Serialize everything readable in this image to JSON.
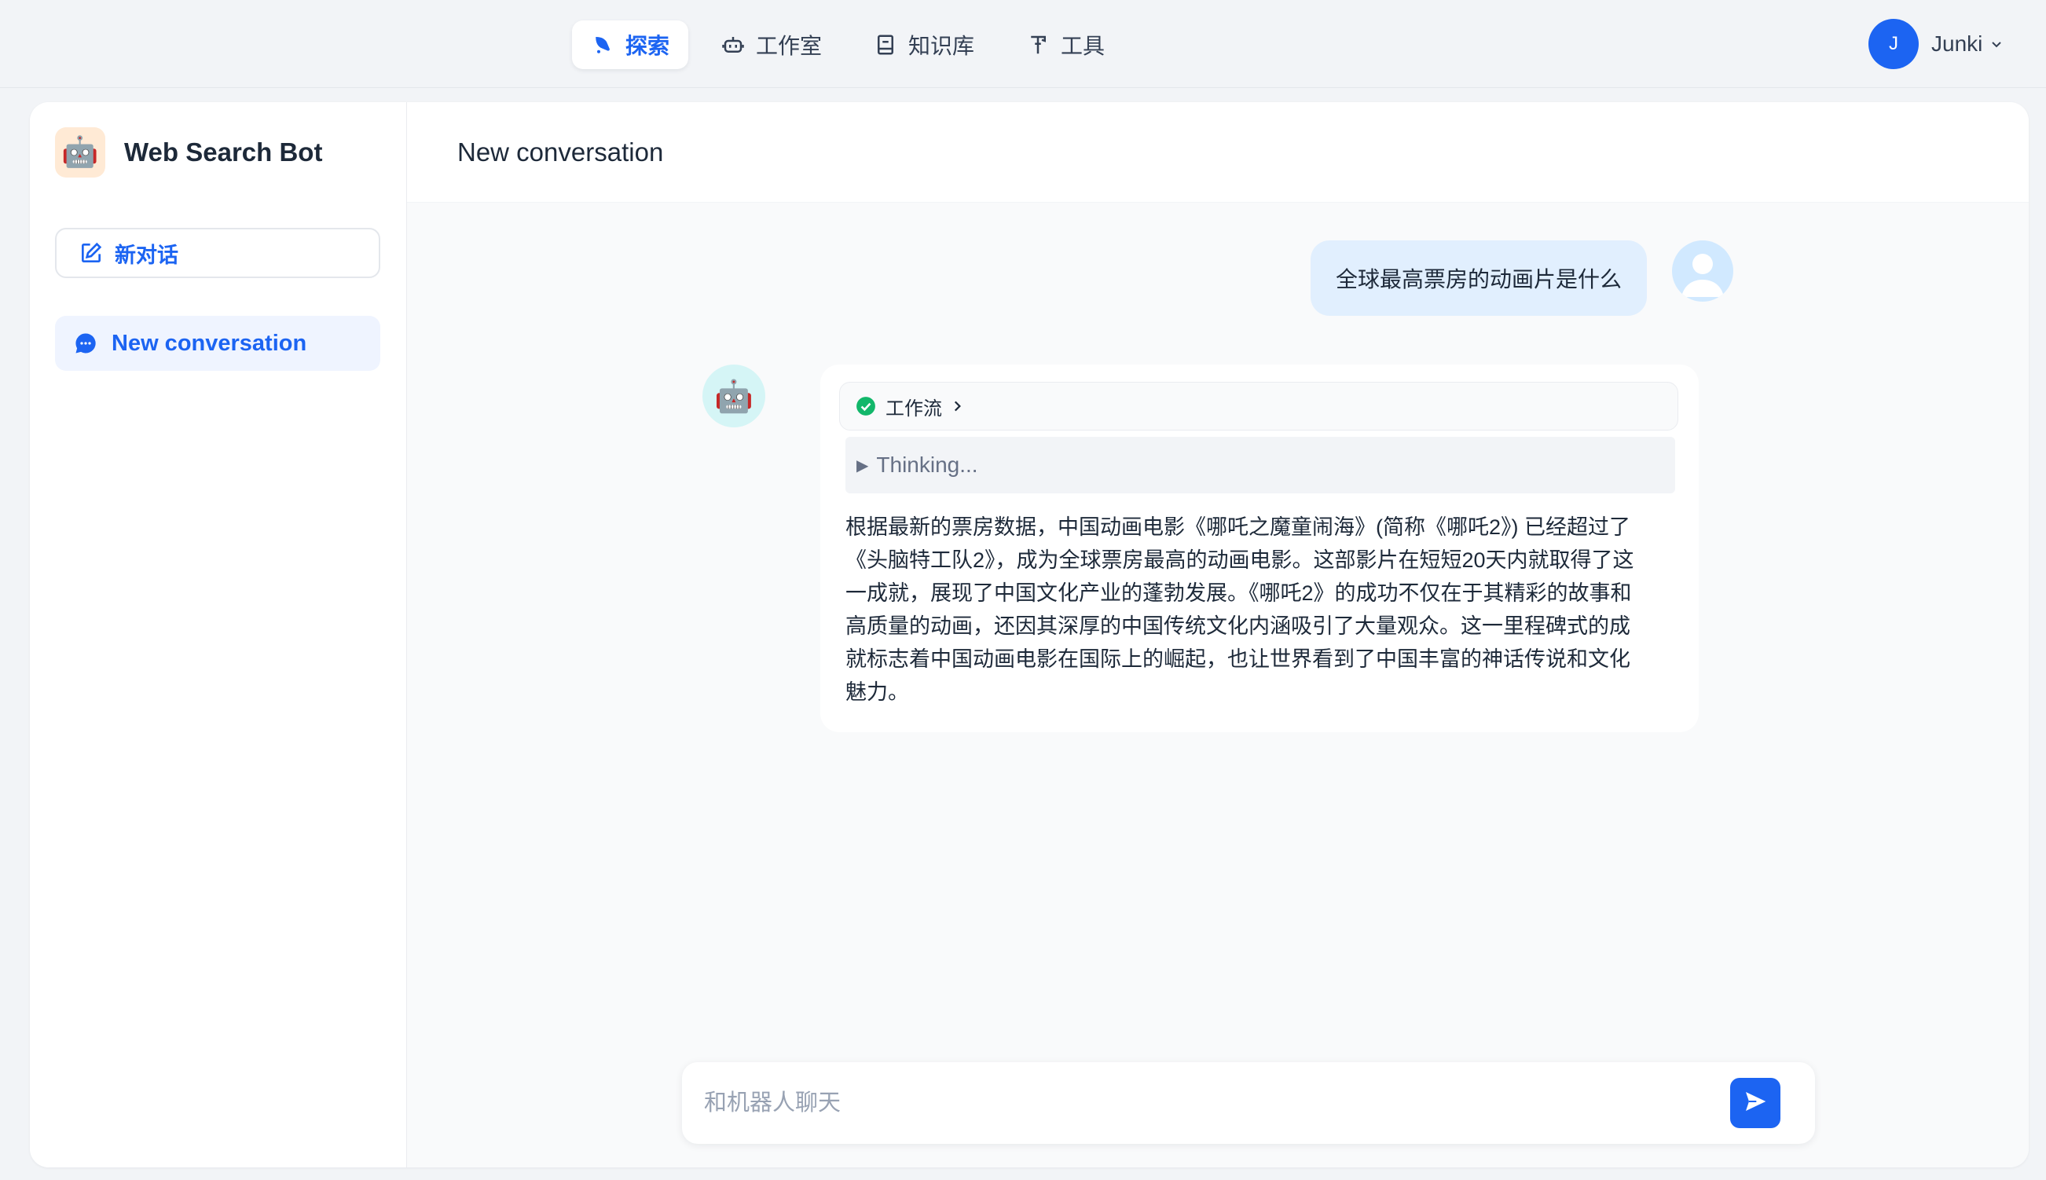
{
  "nav": {
    "items": [
      {
        "label": "探索",
        "icon": "explore-icon",
        "active": true
      },
      {
        "label": "工作室",
        "icon": "robot-icon",
        "active": false
      },
      {
        "label": "知识库",
        "icon": "book-icon",
        "active": false
      },
      {
        "label": "工具",
        "icon": "tool-icon",
        "active": false
      }
    ]
  },
  "user": {
    "initial": "J",
    "name": "Junki"
  },
  "sidebar": {
    "bot_name": "Web Search Bot",
    "bot_emoji": "🤖",
    "new_chat_label": "新对话",
    "conversations": [
      {
        "label": "New conversation",
        "active": true
      }
    ]
  },
  "chat": {
    "title": "New conversation",
    "user_message": "全球最高票房的动画片是什么",
    "bot_emoji": "🤖",
    "workflow_label": "工作流",
    "thinking_label": "Thinking...",
    "answer_lines": [
      "根据最新的票房数据，中国动画电影《哪吒之魔童闹海》(简称《哪吒2》) 已经超过了",
      "《头脑特工队2》，成为全球票房最高的动画电影。这部影片在短短20天内就取得了这",
      "一成就，展现了中国文化产业的蓬勃发展。《哪吒2》的成功不仅在于其精彩的故事和",
      "高质量的动画，还因其深厚的中国传统文化内涵吸引了大量观众。这一里程碑式的成",
      "就标志着中国动画电影在国际上的崛起，也让世界看到了中国丰富的神话传说和文化",
      "魅力。"
    ]
  },
  "input": {
    "placeholder": "和机器人聊天",
    "value": ""
  },
  "colors": {
    "accent": "#1c64f2",
    "user_bubble": "#e1effe",
    "success": "#12b76a"
  }
}
